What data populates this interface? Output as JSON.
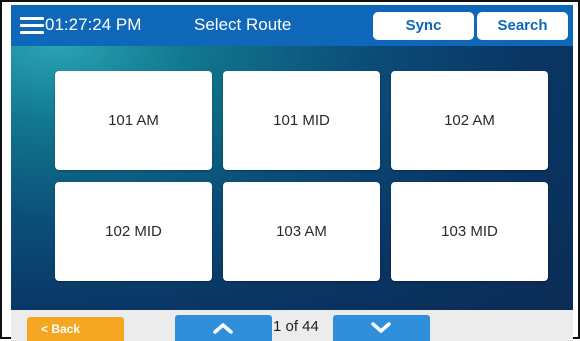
{
  "header": {
    "time": "01:27:24 PM",
    "title": "Select Route",
    "sync_label": "Sync",
    "search_label": "Search"
  },
  "routes": [
    {
      "label": "101 AM"
    },
    {
      "label": "101 MID"
    },
    {
      "label": "102 AM"
    },
    {
      "label": "102 MID"
    },
    {
      "label": "103 AM"
    },
    {
      "label": "103 MID"
    }
  ],
  "footer": {
    "back_label": "< Back",
    "page_indicator": "1 of 44"
  },
  "icons": {
    "menu": "hamburger-menu-icon",
    "page_up": "chevron-up-icon",
    "page_down": "chevron-down-icon"
  },
  "colors": {
    "header_bar": "#0e67b8",
    "back_button": "#f5a623",
    "nav_button": "#2f8fdb"
  }
}
